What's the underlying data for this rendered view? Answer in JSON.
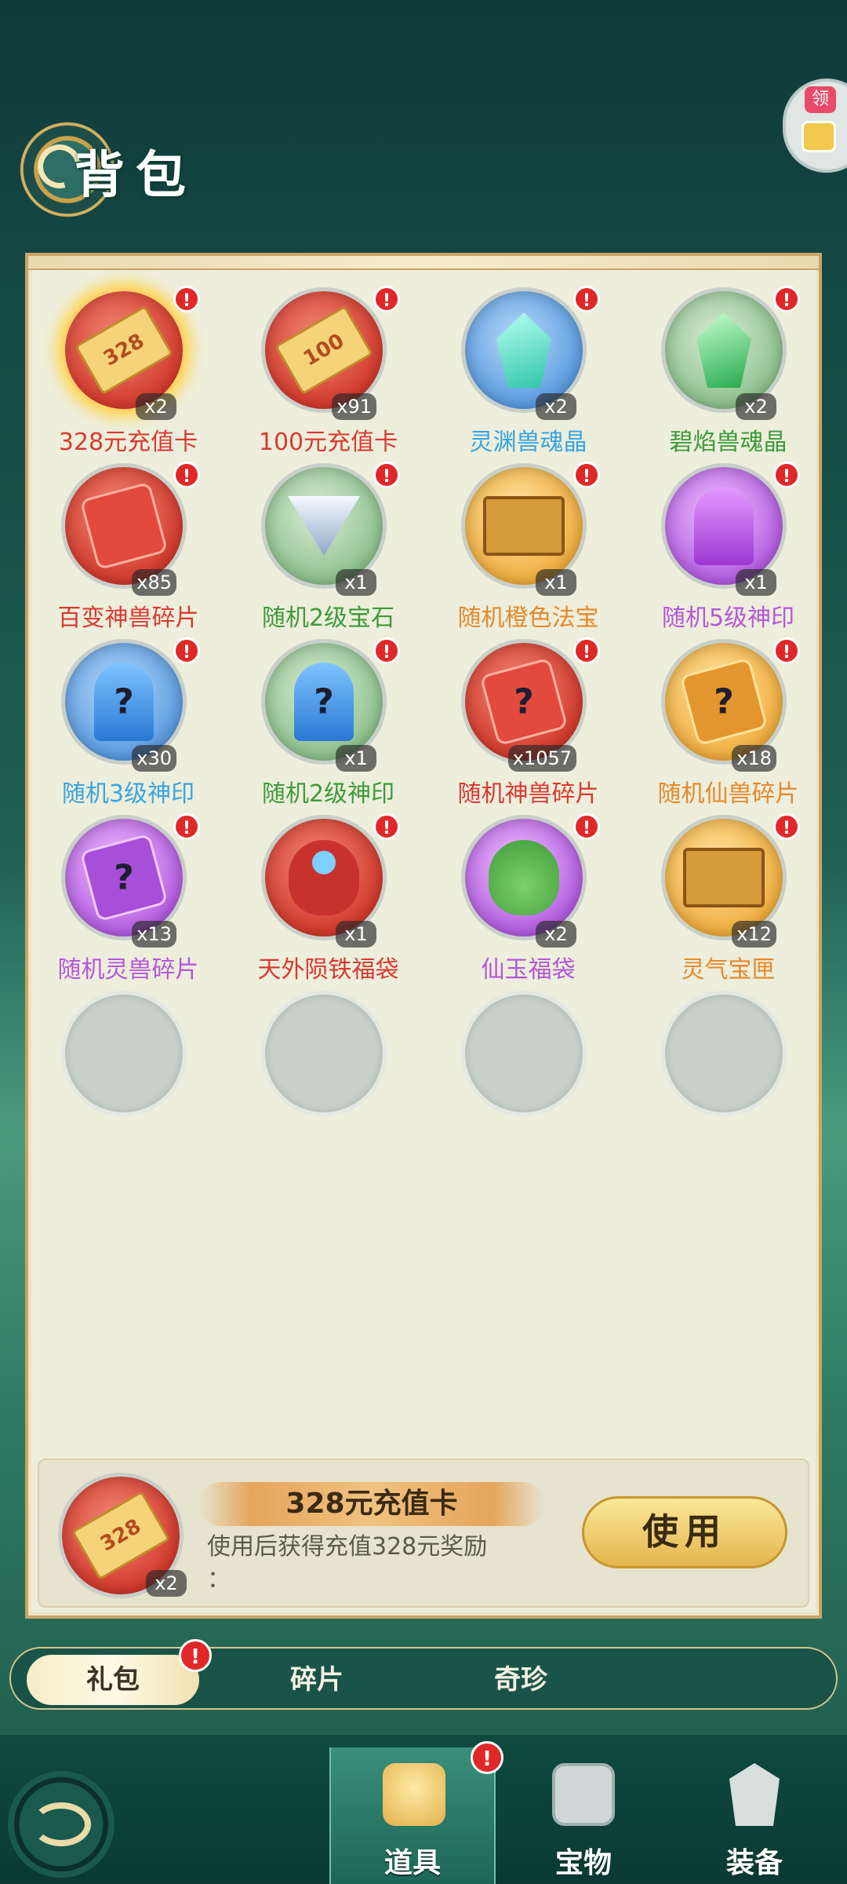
{
  "header": {
    "title": "背包",
    "corner_badge_label": "领"
  },
  "items": [
    {
      "name": "328元充值卡",
      "count": "x2",
      "orb": "red",
      "icon": "ticket",
      "icon_text": "328",
      "name_color": "red",
      "alert": "!",
      "glow": true
    },
    {
      "name": "100元充值卡",
      "count": "x91",
      "orb": "red",
      "icon": "ticket",
      "icon_text": "100",
      "name_color": "red",
      "alert": "!"
    },
    {
      "name": "灵渊兽魂晶",
      "count": "x2",
      "orb": "blue",
      "icon": "crystal-cyan",
      "name_color": "blue",
      "alert": "!"
    },
    {
      "name": "碧焰兽魂晶",
      "count": "x2",
      "orb": "green",
      "icon": "crystal-emerald",
      "name_color": "green",
      "alert": "!"
    },
    {
      "name": "百变神兽碎片",
      "count": "x85",
      "orb": "red",
      "icon": "puzzle-red",
      "name_color": "red",
      "alert": "!"
    },
    {
      "name": "随机2级宝石",
      "count": "x1",
      "orb": "green",
      "icon": "gem",
      "name_color": "green",
      "alert": "!"
    },
    {
      "name": "随机橙色法宝",
      "count": "x1",
      "orb": "gold",
      "icon": "chest",
      "name_color": "orange",
      "alert": "!"
    },
    {
      "name": "随机5级神印",
      "count": "x1",
      "orb": "purple",
      "icon": "seal-purple",
      "name_color": "purple",
      "alert": "!"
    },
    {
      "name": "随机3级神印",
      "count": "x30",
      "orb": "blue",
      "icon": "seal-blue",
      "name_color": "blue",
      "alert": "!",
      "qmark": "?"
    },
    {
      "name": "随机2级神印",
      "count": "x1",
      "orb": "green",
      "icon": "seal-blue",
      "name_color": "green",
      "alert": "!",
      "qmark": "?"
    },
    {
      "name": "随机神兽碎片",
      "count": "x1057",
      "orb": "red",
      "icon": "puzzle-red",
      "name_color": "red",
      "alert": "!",
      "qmark": "?"
    },
    {
      "name": "随机仙兽碎片",
      "count": "x18",
      "orb": "gold",
      "icon": "puzzle-gold",
      "name_color": "orange",
      "alert": "!",
      "qmark": "?"
    },
    {
      "name": "随机灵兽碎片",
      "count": "x13",
      "orb": "purple",
      "icon": "puzzle-purple",
      "name_color": "purple",
      "alert": "!",
      "qmark": "?"
    },
    {
      "name": "天外陨铁福袋",
      "count": "x1",
      "orb": "red",
      "icon": "bag-red",
      "name_color": "red",
      "alert": "!"
    },
    {
      "name": "仙玉福袋",
      "count": "x2",
      "orb": "purple",
      "icon": "bag-green",
      "name_color": "purple",
      "alert": "!"
    },
    {
      "name": "灵气宝匣",
      "count": "x12",
      "orb": "gold",
      "icon": "chest",
      "name_color": "orange",
      "alert": "!"
    },
    {
      "empty": true
    },
    {
      "empty": true
    },
    {
      "empty": true
    },
    {
      "empty": true
    }
  ],
  "detail": {
    "title": "328元充值卡",
    "description": "使用后获得充值328元奖励",
    "description_suffix": "：",
    "count": "x2",
    "icon_text": "328",
    "use_label": "使用"
  },
  "categories": [
    {
      "label": "礼包",
      "active": true,
      "alert": "!"
    },
    {
      "label": "碎片",
      "active": false
    },
    {
      "label": "奇珍",
      "active": false
    }
  ],
  "nav": [
    {
      "label": "道具",
      "active": true,
      "icon": "props-icon",
      "alert": "!"
    },
    {
      "label": "宝物",
      "active": false,
      "icon": "treasure-icon"
    },
    {
      "label": "装备",
      "active": false,
      "icon": "equip-icon"
    }
  ]
}
